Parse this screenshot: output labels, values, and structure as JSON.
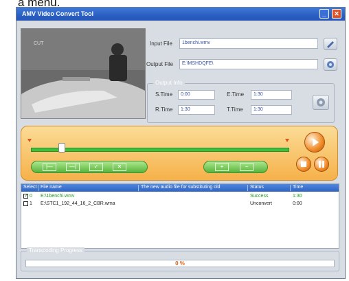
{
  "page_caption": "a menu.",
  "window": {
    "title": "AMV Video Convert Tool",
    "min_glyph": "_",
    "close_glyph": "✕"
  },
  "preview": {
    "overlay_text": "CUT"
  },
  "input_file": {
    "label": "Input File",
    "value": "1benchi.wmv"
  },
  "output_file": {
    "label": "Output File",
    "value": "E:\\MSHDQFE\\"
  },
  "output_info": {
    "legend": "Output Info",
    "s_time_label": "S.Time",
    "s_time": "0:00",
    "e_time_label": "E.Time",
    "e_time": "1:30",
    "r_time_label": "R.Time",
    "r_time": "1:30",
    "t_time_label": "T.Time",
    "t_time": "1:30"
  },
  "playback": {
    "slider_fraction": 0.12
  },
  "file_list": {
    "columns": [
      "Select",
      "File name",
      "The new audio file for substituting old",
      "Status",
      "Time"
    ],
    "rows": [
      {
        "checked": true,
        "index": "0",
        "file": "E:\\1benchi.wmv",
        "audio": "",
        "status": "Success",
        "time": "1:30",
        "color": "#1e9a1e"
      },
      {
        "checked": false,
        "index": "1",
        "file": "E:\\STC1_192_44_16_2_CBR.wma",
        "audio": "",
        "status": "Unconvert",
        "time": "0:00",
        "color": "#222222"
      }
    ]
  },
  "progress": {
    "legend": "Transcoding Progress",
    "value_text": "0 %",
    "value": 0
  },
  "colors": {
    "accent": "#2a5fc2",
    "panel": "#f6b14a",
    "slider": "#3fbf3f",
    "progress_text": "#e06010"
  }
}
